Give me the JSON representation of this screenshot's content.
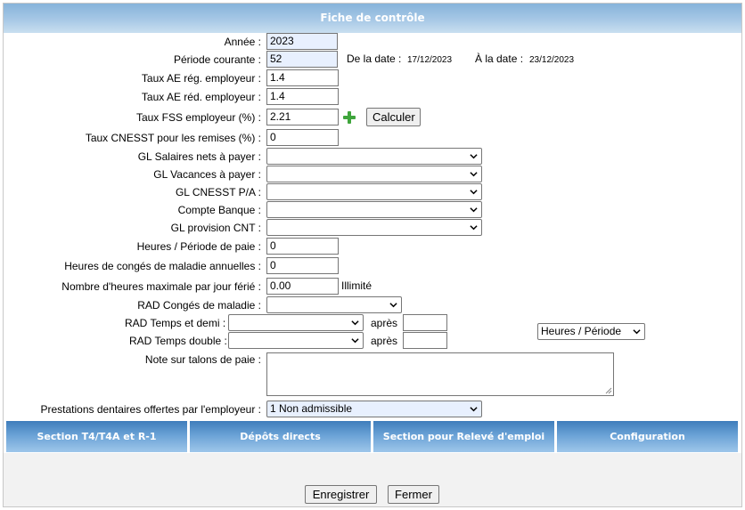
{
  "title": "Fiche de contrôle",
  "fields": {
    "annee": {
      "label": "Année :",
      "value": "2023"
    },
    "periode": {
      "label": "Période courante :",
      "value": "52"
    },
    "de_la_date": {
      "label": "De la date :",
      "value": "17/12/2023"
    },
    "a_la_date": {
      "label": "À la date :",
      "value": "23/12/2023"
    },
    "taux_ae_reg": {
      "label": "Taux AE rég. employeur :",
      "value": "1.4"
    },
    "taux_ae_red": {
      "label": "Taux AE réd. employeur :",
      "value": "1.4"
    },
    "taux_fss": {
      "label": "Taux FSS employeur (%) :",
      "value": "2.21"
    },
    "calculer": "Calculer",
    "taux_cnesst": {
      "label": "Taux CNESST pour les remises (%) :",
      "value": "0"
    },
    "gl_salaires": {
      "label": "GL Salaires nets à payer :",
      "value": ""
    },
    "gl_vacances": {
      "label": "GL Vacances à payer :",
      "value": ""
    },
    "gl_cnesst": {
      "label": "GL CNESST P/A :",
      "value": ""
    },
    "compte_banque": {
      "label": "Compte Banque :",
      "value": ""
    },
    "gl_provision": {
      "label": "GL provision CNT :",
      "value": ""
    },
    "heures_periode": {
      "label": "Heures / Période de paie :",
      "value": "0"
    },
    "heures_conges": {
      "label": "Heures de congés de maladie annuelles :",
      "value": "0"
    },
    "heures_max": {
      "label": "Nombre d'heures maximale par jour férié :",
      "value": "0.00",
      "suffix": "Illimité"
    },
    "rad_conges": {
      "label": "RAD Congés de maladie :",
      "value": ""
    },
    "rad_temps_demi": {
      "label": "RAD Temps et demi :",
      "value": "",
      "apres_label": "après",
      "apres_value": ""
    },
    "rad_temps_double": {
      "label": "RAD Temps double :",
      "value": "",
      "apres_label": "après",
      "apres_value": ""
    },
    "heures_unit": "Heures / Période",
    "note": {
      "label": "Note sur talons de paie :",
      "value": ""
    },
    "prestations": {
      "label": "Prestations dentaires offertes par l'employeur :",
      "value": "1 Non admissible"
    }
  },
  "tabs": [
    "Section T4/T4A et R-1",
    "Dépôts directs",
    "Section pour Relevé d'emploi",
    "Configuration"
  ],
  "buttons": {
    "save": "Enregistrer",
    "close": "Fermer"
  },
  "colors": {
    "header": "#9fc3e4",
    "tab": "#5b95cd",
    "add_icon": "#3fa53c"
  }
}
